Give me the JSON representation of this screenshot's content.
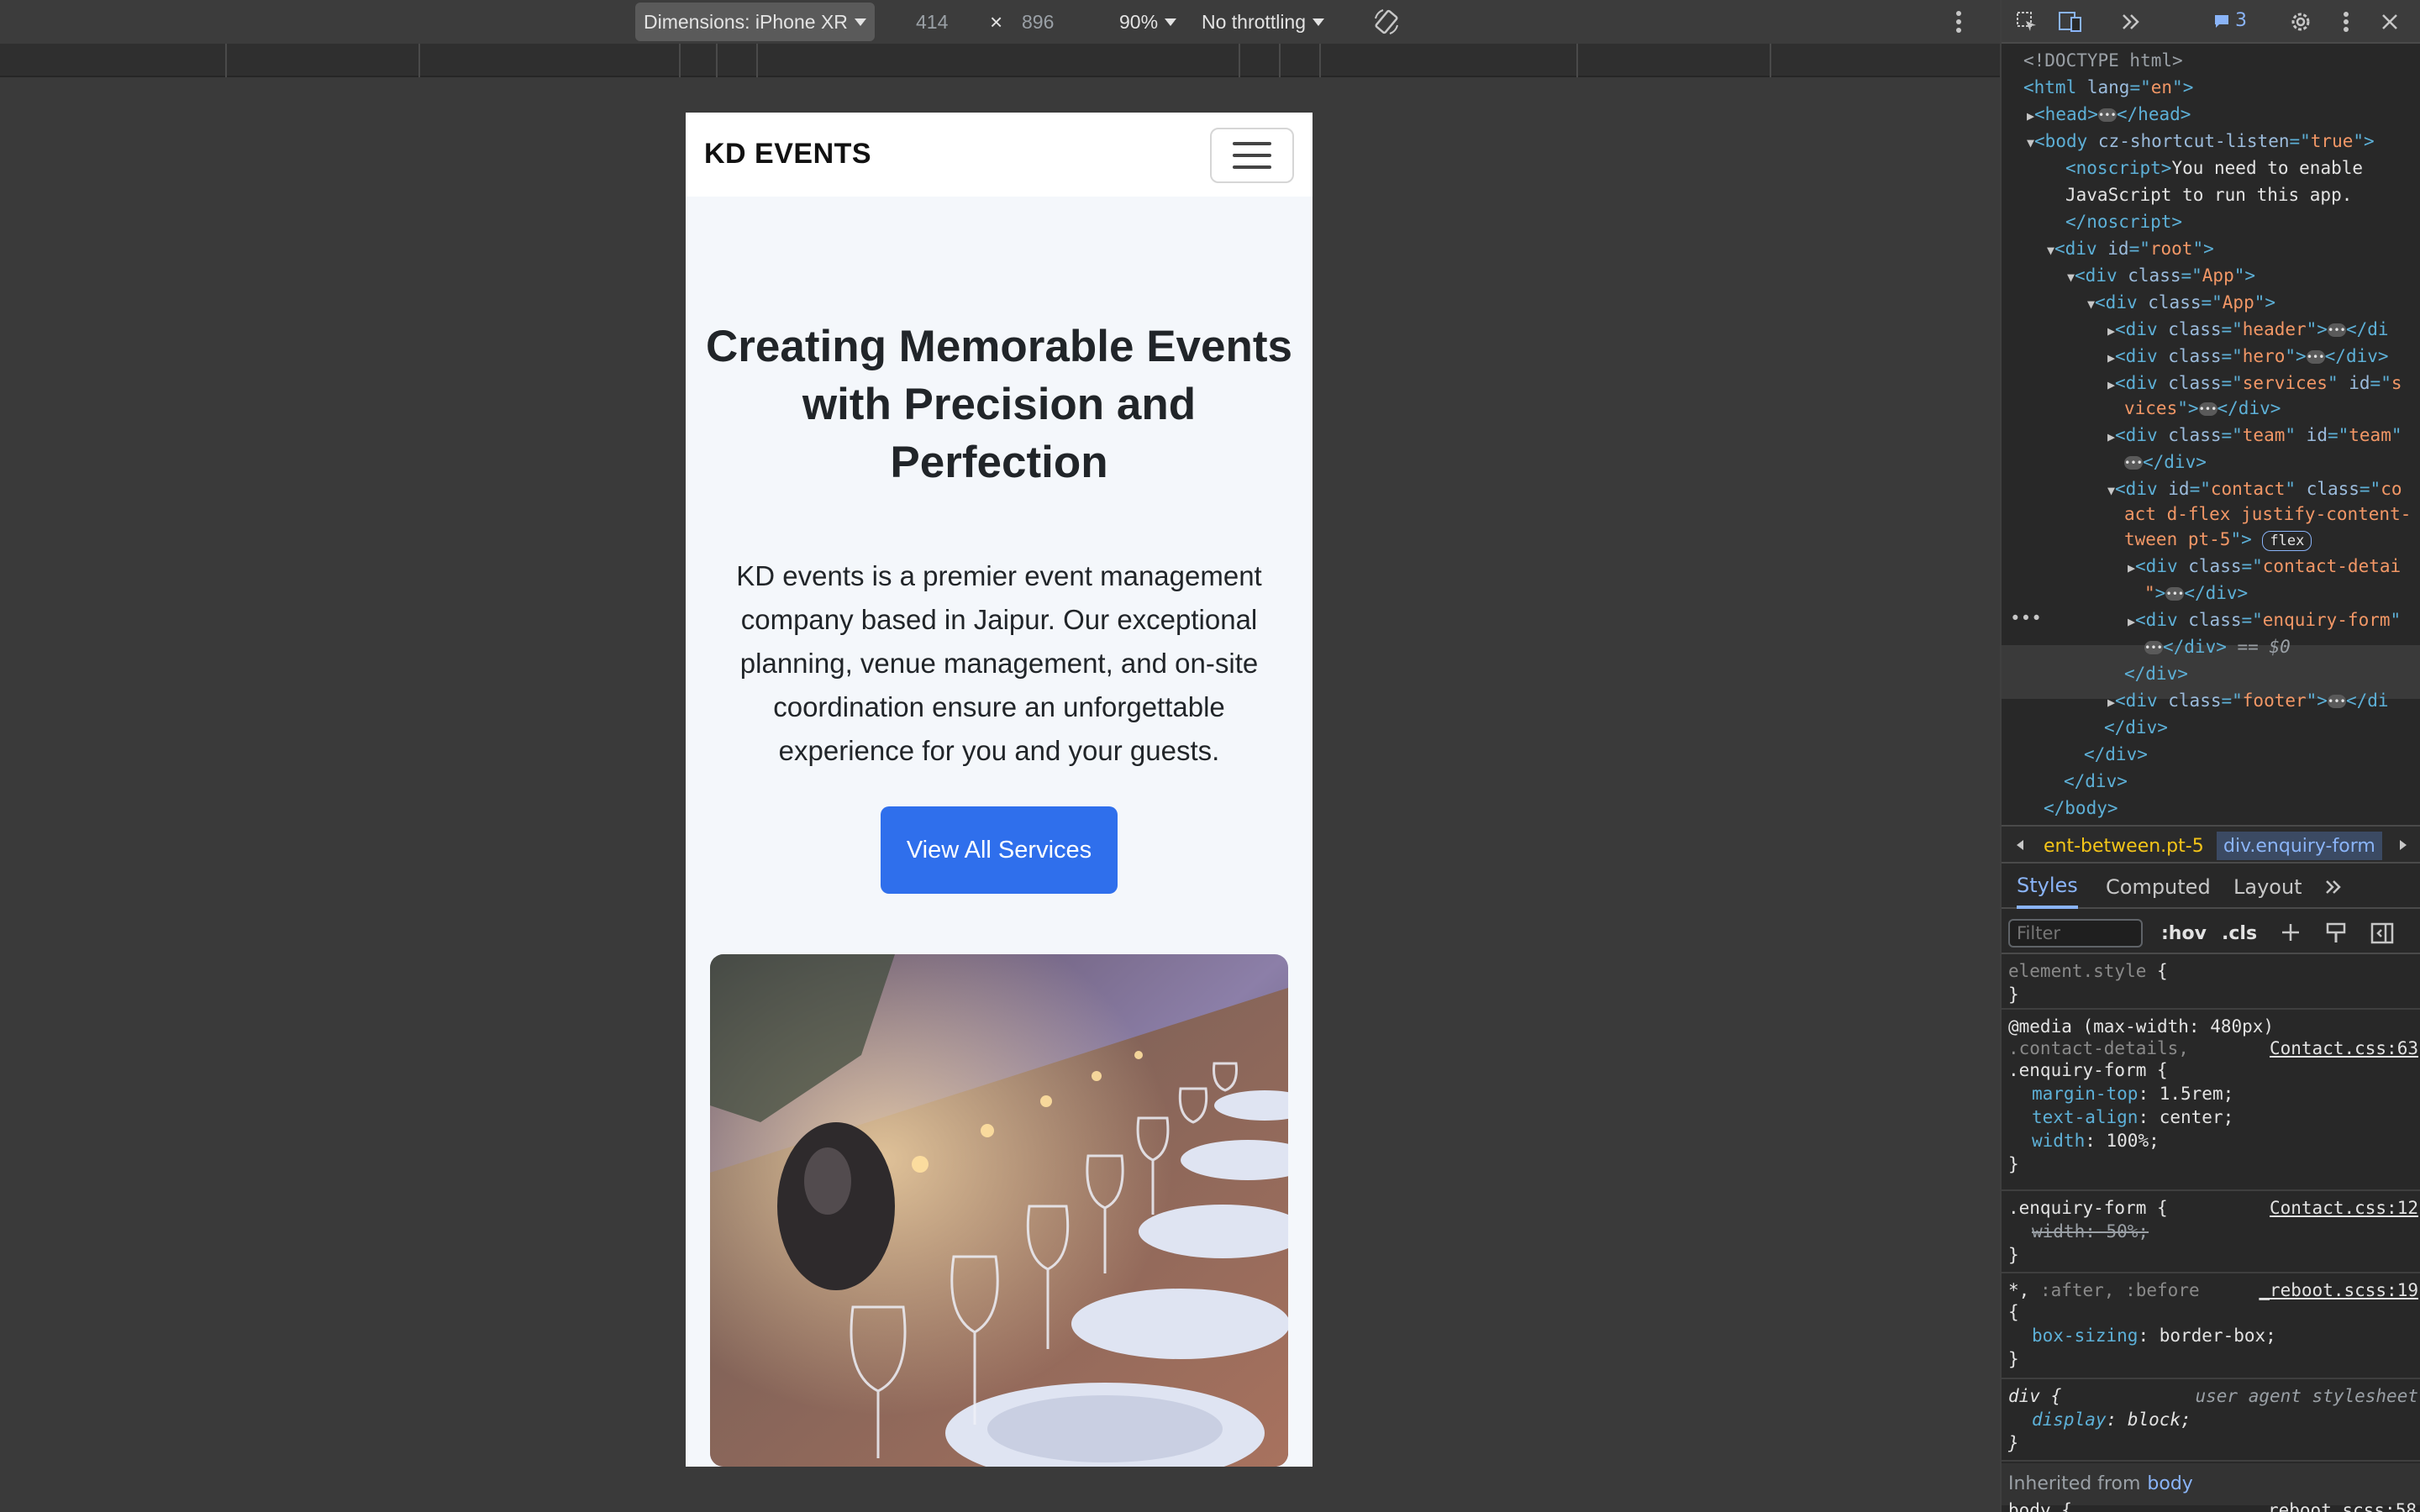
{
  "device_toolbar": {
    "dimensions_label": "Dimensions: iPhone XR",
    "width": "414",
    "times": "×",
    "height": "896",
    "zoom": "90%",
    "throttling": "No throttling"
  },
  "site": {
    "brand": "KD EVENTS",
    "hero_title": "Creating Memorable Events with Precision and Perfection",
    "hero_text": "KD events is a premier event management company based in Jaipur. Our exceptional planning, venue management, and on-site coordination ensure an unforgettable experience for you and your guests.",
    "cta_label": "View All Services"
  },
  "devtools": {
    "issues_count": "3",
    "dom": {
      "doctype": "<!DOCTYPE html>",
      "html_lang": "en",
      "body_attr": "cz-shortcut-listen",
      "body_val": "true",
      "noscript_text_1": "You need to enable",
      "noscript_text_2": "JavaScript to run this app.",
      "root_id": "root",
      "app_class": "App",
      "header_class": "header",
      "hero_class": "hero",
      "services_class": "services",
      "services_id_fragment": "s",
      "services_wrap": "vices",
      "team_class": "team",
      "team_id": "team",
      "contact_id": "contact",
      "contact_class_fragment": "co",
      "contact_wrap_1": "act d-flex justify-content-",
      "contact_wrap_2": "tween pt-5",
      "flex_badge": "flex",
      "contact_details_class": "contact-detai",
      "enquiry_class": "enquiry-form",
      "selected_marker": "== $0",
      "footer_class": "footer"
    },
    "breadcrumbs": [
      "ent-between.pt-5",
      "div.enquiry-form"
    ],
    "tabs": [
      "Styles",
      "Computed",
      "Layout"
    ],
    "filter_placeholder": "Filter",
    "filter_hov": ":hov",
    "filter_cls": ".cls",
    "styles": {
      "element_style": "element.style",
      "media_query": "@media (max-width: 480px)",
      "rule1_selector_dim": ".contact-details,",
      "rule1_selector": ".enquiry-form",
      "rule1_source": "Contact.css:63",
      "rule1_props": [
        {
          "name": "margin-top",
          "value": "1.5rem;"
        },
        {
          "name": "text-align",
          "value": "center;"
        },
        {
          "name": "width",
          "value": "100%;"
        }
      ],
      "rule2_selector": ".enquiry-form",
      "rule2_source": "Contact.css:12",
      "rule2_prop": "width: 50%;",
      "rule3_selector": "*,",
      "rule3_selector_dim": ":after, :before",
      "rule3_source": "_reboot.scss:19",
      "rule3_prop_name": "box-sizing",
      "rule3_prop_value": "border-box;",
      "rule4_selector": "div",
      "rule4_source": "user agent stylesheet",
      "rule4_prop_name": "display",
      "rule4_prop_value": "block;",
      "inherited_label": "Inherited from",
      "inherited_link": "body",
      "rule5_selector": "body {",
      "rule5_source": "reboot.scss:58"
    }
  }
}
